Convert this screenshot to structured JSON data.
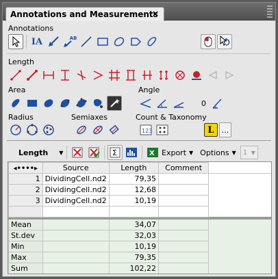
{
  "window": {
    "title": "Annotations and Measurements",
    "close": "×"
  },
  "sections": {
    "annotations": "Annotations",
    "length": "Length",
    "area": "Area",
    "angle": "Angle",
    "radius": "Radius",
    "semiaxes": "Semiaxes",
    "count": "Count & Taxonomy"
  },
  "tool_text": {
    "text_tool": "IA",
    "arrow_label_tool": "AB",
    "angle_value": "0",
    "taxonomy": "L",
    "more": "..."
  },
  "results_toolbar": {
    "measure_type": "Length",
    "export": "Export",
    "options": "Options",
    "sample": "1"
  },
  "table": {
    "columns": [
      "Source",
      "Length",
      "Comment"
    ],
    "rows": [
      {
        "index": "1",
        "source": "DividingCell.nd2",
        "length": "79,35",
        "comment": ""
      },
      {
        "index": "2",
        "source": "DividingCell.nd2",
        "length": "12,68",
        "comment": ""
      },
      {
        "index": "3",
        "source": "DividingCell.nd2",
        "length": "10,19",
        "comment": ""
      }
    ],
    "stats": [
      {
        "label": "Mean",
        "value": "34,07"
      },
      {
        "label": "St.dev",
        "value": "32,03"
      },
      {
        "label": "Min",
        "value": "10,19"
      },
      {
        "label": "Max",
        "value": "79,35"
      },
      {
        "label": "Sum",
        "value": "102,22"
      }
    ]
  },
  "colors": {
    "accent_red": "#c8202a",
    "accent_blue": "#1f4fa0",
    "stat_bg": "#e8f1e6"
  }
}
